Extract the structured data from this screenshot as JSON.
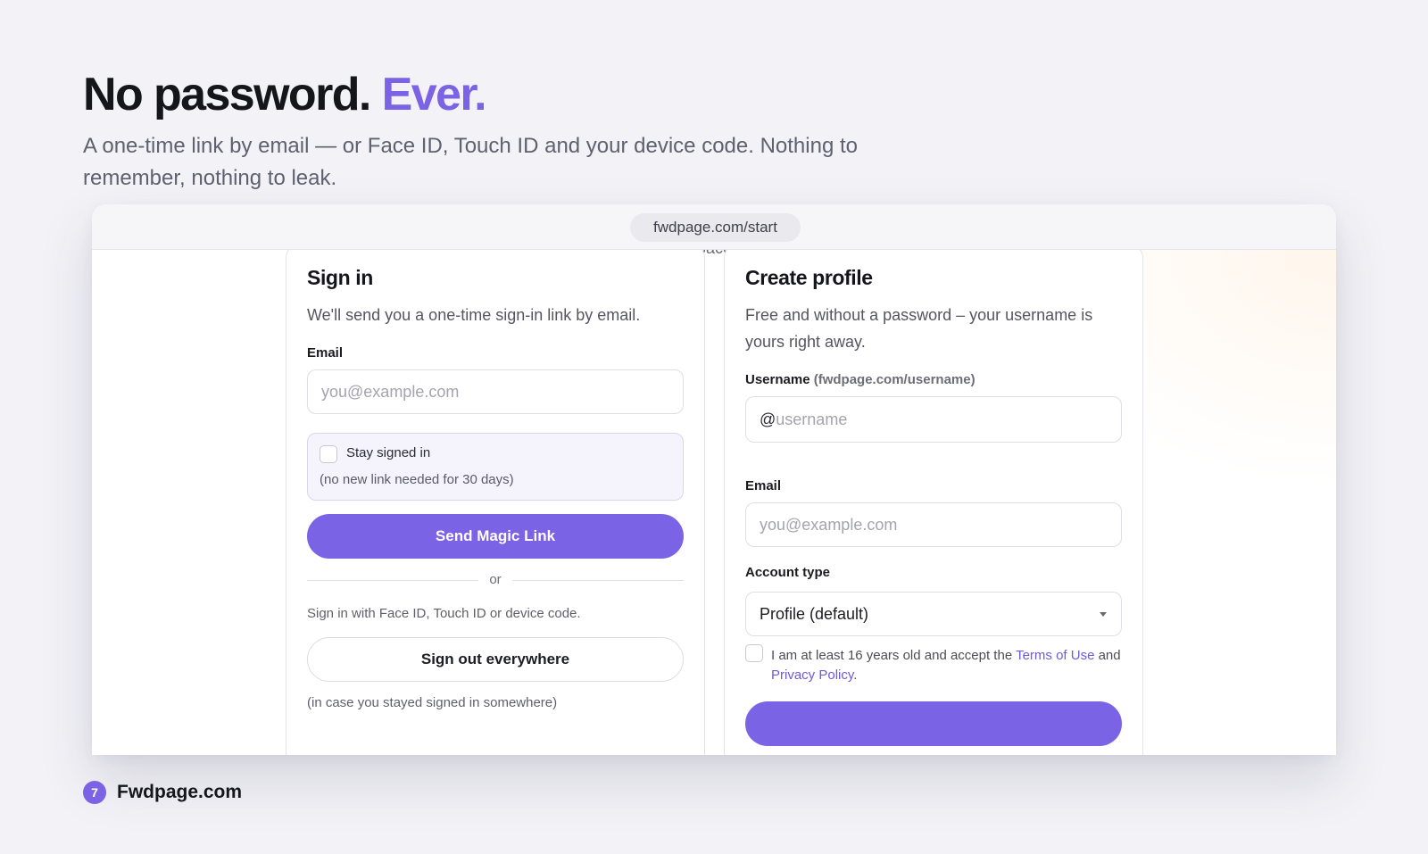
{
  "hero": {
    "title_main": "No password.",
    "title_accent": "Ever.",
    "subtitle": "A one-time link by email — or Face ID, Touch ID and your device code. Nothing to remember, nothing to leak."
  },
  "browser": {
    "url": "fwdpage.com/start",
    "cut_text": "pace."
  },
  "signin": {
    "title": "Sign in",
    "description": "We'll send you a one-time sign-in link by email.",
    "email_label": "Email",
    "email_placeholder": "you@example.com",
    "stay_label": "Stay signed in",
    "stay_note": "(no new link needed for 30 days)",
    "send_button": "Send Magic Link",
    "or_text": "or",
    "device_text": "Sign in with Face ID, Touch ID or device code.",
    "signout_button": "Sign out everywhere",
    "signout_note": "(in case you stayed signed in somewhere)"
  },
  "create": {
    "title": "Create profile",
    "description": "Free and without a password – your username is yours right away.",
    "username_label": "Username",
    "username_hint": "(fwdpage.com/username)",
    "username_prefix": "@",
    "username_placeholder": "username",
    "email_label": "Email",
    "email_placeholder": "you@example.com",
    "account_type_label": "Account type",
    "account_type_value": "Profile (default)",
    "terms_prefix": "I am at least 16 years old and accept the ",
    "terms_link": "Terms of Use",
    "terms_mid": " and ",
    "privacy_link": "Privacy Policy",
    "terms_suffix": "."
  },
  "brand": {
    "logo_glyph": "7",
    "name": "Fwdpage.com"
  },
  "colors": {
    "accent": "#7b63e6",
    "background": "#f2f2f7"
  }
}
